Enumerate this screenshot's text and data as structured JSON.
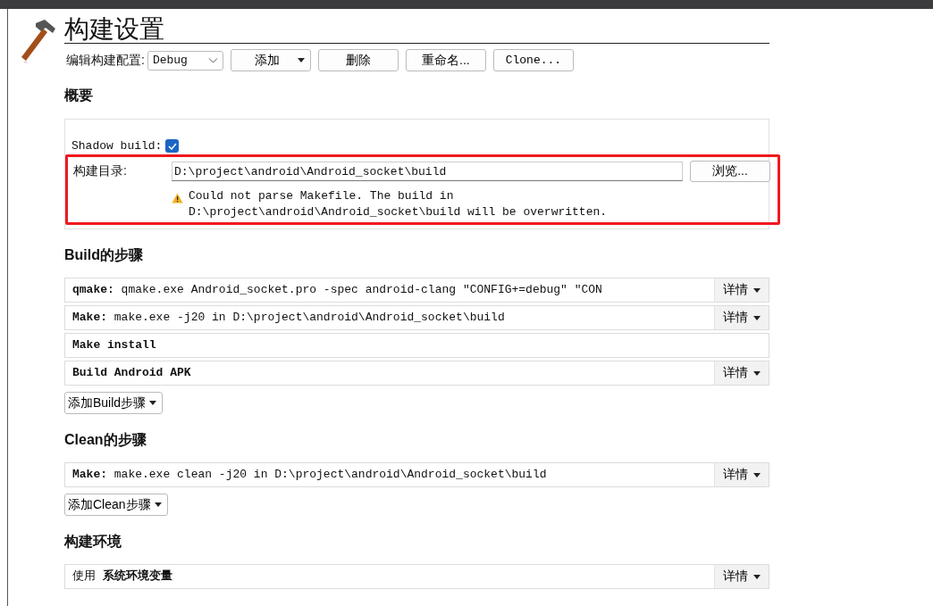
{
  "page": {
    "title": "构建设置"
  },
  "config": {
    "label": "编辑构建配置:",
    "value": "Debug",
    "buttons": [
      {
        "label": "添加",
        "menu": true
      },
      {
        "label": "删除",
        "menu": false
      },
      {
        "label": "重命名...",
        "menu": false
      },
      {
        "label": "Clone...",
        "menu": false
      }
    ]
  },
  "overview": {
    "heading": "概要",
    "shadow_build": {
      "label": "Shadow build:",
      "checked": true
    },
    "build_directory": {
      "label": "构建目录:",
      "value": "D:\\project\\android\\Android_socket\\build",
      "browse": "浏览...",
      "highlighted": true,
      "warning": "Could not parse Makefile. The build in D:\\project\\android\\Android_socket\\build will be overwritten."
    }
  },
  "build_steps": {
    "heading": "Build的步骤",
    "steps": [
      {
        "text": "**qmake:** qmake.exe Android_socket.pro -spec android-clang \"CONFIG+=debug\" \"CON",
        "details": "详情"
      },
      {
        "text": "**Make:** make.exe -j20 in D:\\project\\android\\Android_socket\\build",
        "details": "详情"
      },
      {
        "text": "**Make install**"
      },
      {
        "text": "**Build Android APK**",
        "details": "详情"
      }
    ],
    "add": "添加Build步骤"
  },
  "clean_steps": {
    "heading": "Clean的步骤",
    "steps": [
      {
        "text": "**Make:** make.exe clean -j20 in D:\\project\\android\\Android_socket\\build",
        "details": "详情"
      }
    ],
    "add": "添加Clean步骤"
  },
  "environment": {
    "heading": "构建环境",
    "text": "使用 **系统环境变量**",
    "details": "详情"
  }
}
